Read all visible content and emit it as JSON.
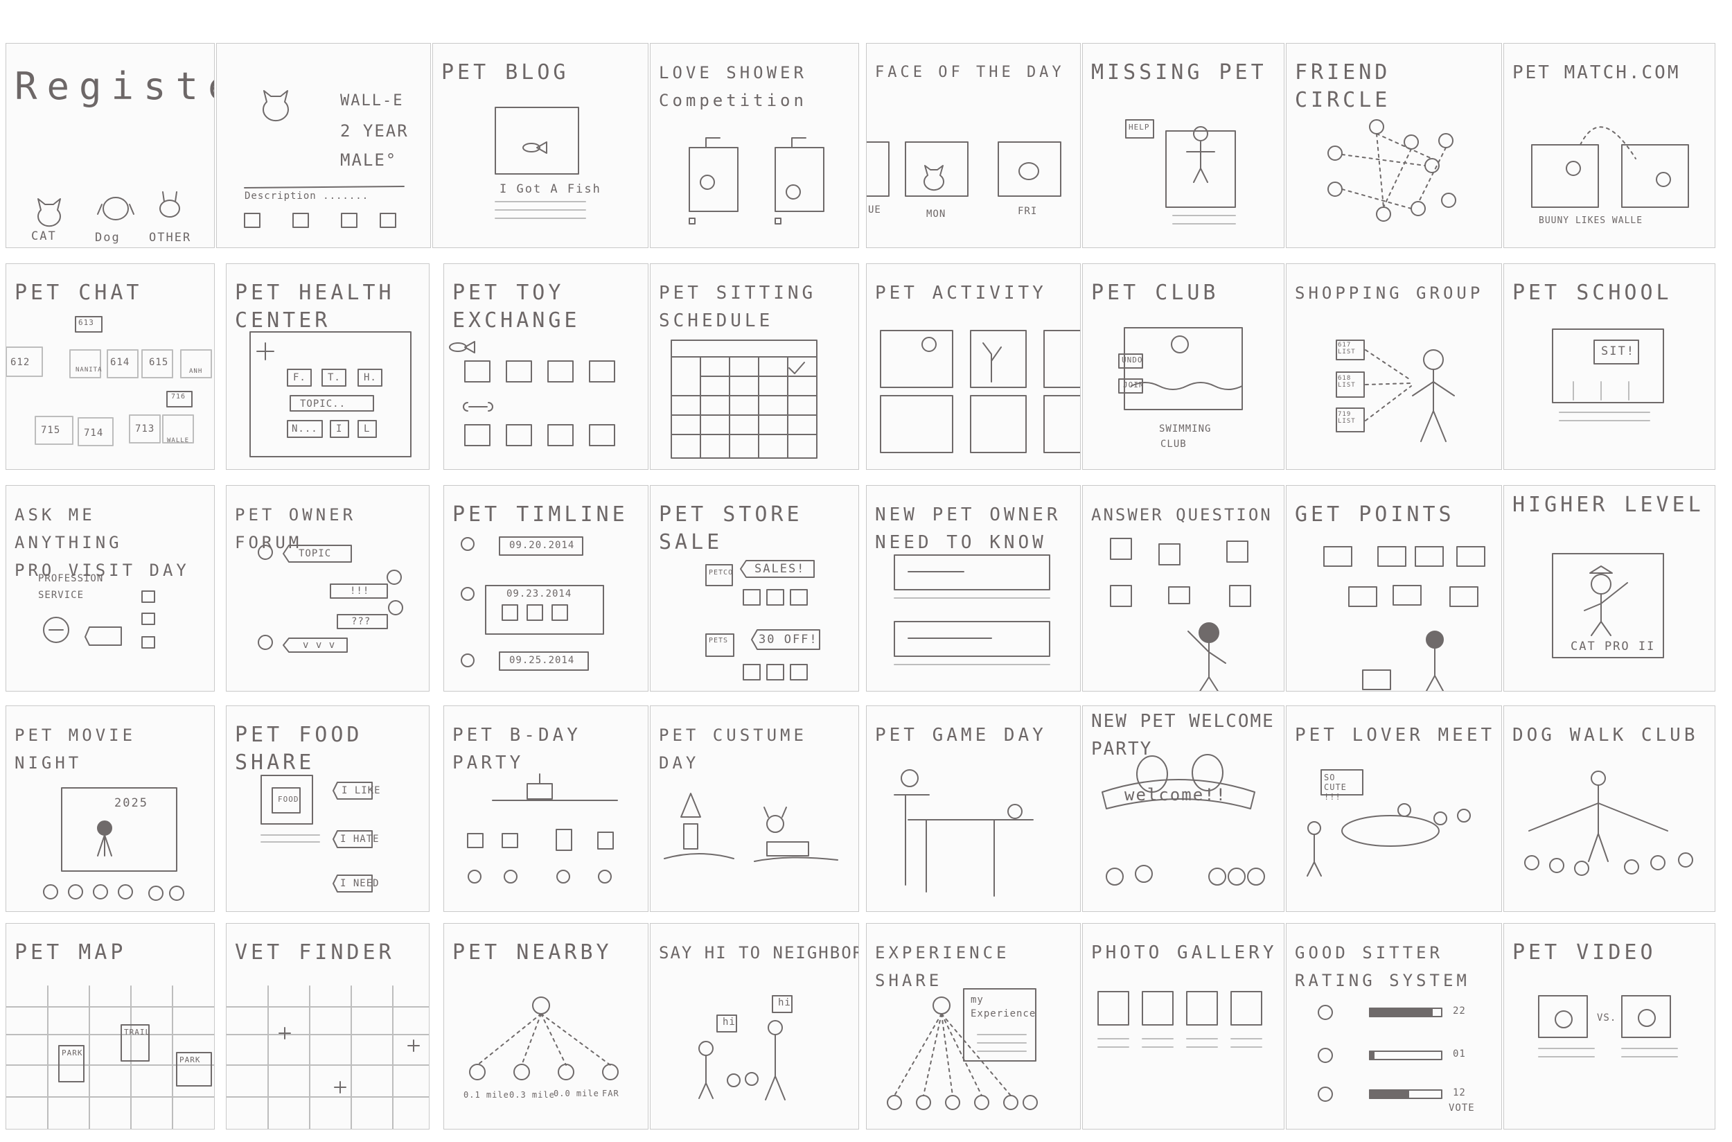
{
  "panels": [
    {
      "id": "register",
      "title": "Register",
      "labels": [
        "CAT",
        "Dog",
        "OTHER"
      ]
    },
    {
      "id": "profile",
      "title": "",
      "labels": [
        "WALL-E",
        "2 YEAR",
        "MALE°",
        "Description ......."
      ]
    },
    {
      "id": "pet-blog",
      "title": "PET BLOG",
      "labels": [
        "I Got A Fish"
      ]
    },
    {
      "id": "love-shower",
      "title": "LOVE SHOWER\nCompetition",
      "labels": []
    },
    {
      "id": "face-of-the-day",
      "title": "FACE OF THE DAY",
      "labels": [
        "UE",
        "MON",
        "FRI"
      ]
    },
    {
      "id": "missing-pet",
      "title": "MISSING PET",
      "labels": [
        "HELP"
      ]
    },
    {
      "id": "friend-circle",
      "title": "FRIEND CIRCLE",
      "labels": []
    },
    {
      "id": "pet-match",
      "title": "PET MATCH.COM",
      "labels": [
        "BUUNY LIKES WALLE"
      ]
    },
    {
      "id": "pet-chat",
      "title": "PET CHAT",
      "labels": [
        "612",
        "613",
        "614",
        "615",
        "715",
        "714",
        "713",
        "716",
        "WALLE",
        "NANITA",
        "ANH"
      ]
    },
    {
      "id": "pet-health",
      "title": "PET HEALTH\nCENTER",
      "labels": [
        "TOPIC..",
        "F.",
        "T.",
        "H.",
        "N...",
        "I",
        "L"
      ]
    },
    {
      "id": "pet-toy",
      "title": "PET TOY\nEXCHANGE",
      "labels": []
    },
    {
      "id": "pet-sitting",
      "title": "PET SITTING\nSCHEDULE",
      "labels": []
    },
    {
      "id": "pet-activity",
      "title": "PET ACTIVITY",
      "labels": []
    },
    {
      "id": "pet-club",
      "title": "PET CLUB",
      "labels": [
        "UNDO",
        "JOIN",
        "SWIMMING",
        "CLUB"
      ]
    },
    {
      "id": "shopping-group",
      "title": "SHOPPING GROUP",
      "labels": [
        "617 LIST",
        "618 LIST",
        "719 LIST"
      ]
    },
    {
      "id": "pet-school",
      "title": "PET SCHOOL",
      "labels": [
        "SIT!"
      ]
    },
    {
      "id": "ask-me",
      "title": "ASK ME ANYTHING\nPRO VISIT DAY",
      "labels": [
        "PROFESSION",
        "SERVICE"
      ]
    },
    {
      "id": "owner-forum",
      "title": "PET OWNER FORUM",
      "labels": [
        "TOPIC",
        "!!!",
        "???",
        "v v v"
      ]
    },
    {
      "id": "pet-timeline",
      "title": "PET TIMLINE",
      "labels": [
        "09.20.2014",
        "09.23.2014",
        "09.25.2014"
      ]
    },
    {
      "id": "store-sale",
      "title": "PET STORE SALE",
      "labels": [
        "SALES!",
        "30 OFF!",
        "PETCO",
        "PETS"
      ]
    },
    {
      "id": "new-owner",
      "title": "NEW PET OWNER\nNEED TO KNOW",
      "labels": []
    },
    {
      "id": "answer-question",
      "title": "ANSWER QUESTION",
      "labels": []
    },
    {
      "id": "get-points",
      "title": "GET POINTS",
      "labels": []
    },
    {
      "id": "higher-level",
      "title": "HIGHER LEVEL",
      "labels": [
        "CAT PRO II"
      ]
    },
    {
      "id": "movie-night",
      "title": "PET MOVIE NIGHT",
      "labels": [
        "2025"
      ]
    },
    {
      "id": "food-share",
      "title": "PET FOOD SHARE",
      "labels": [
        "I LIKE",
        "I HATE",
        "I NEED",
        "FOOD"
      ]
    },
    {
      "id": "bday-party",
      "title": "PET B-DAY PARTY",
      "labels": []
    },
    {
      "id": "costume-day",
      "title": "PET CUSTUME DAY",
      "labels": []
    },
    {
      "id": "game-day",
      "title": "PET GAME DAY",
      "labels": []
    },
    {
      "id": "welcome-party",
      "title": "NEW PET WELCOME\nPARTY",
      "labels": [
        "welcome!!"
      ]
    },
    {
      "id": "lover-meet",
      "title": "PET LOVER MEET",
      "labels": [
        "SO CUTE !!!"
      ]
    },
    {
      "id": "dog-walk",
      "title": "DOG WALK CLUB",
      "labels": []
    },
    {
      "id": "pet-map",
      "title": "PET MAP",
      "labels": [
        "PARK",
        "TRAIL",
        "PARK"
      ]
    },
    {
      "id": "vet-finder",
      "title": "VET FINDER",
      "labels": []
    },
    {
      "id": "pet-nearby",
      "title": "PET NEARBY",
      "labels": [
        "0.1 mile",
        "0.3 mile",
        "0.0 mile",
        "FAR"
      ]
    },
    {
      "id": "say-hi",
      "title": "SAY HI TO NEIGHBOR",
      "labels": [
        "hi",
        "hi"
      ]
    },
    {
      "id": "experience-share",
      "title": "EXPERIENCE\nSHARE",
      "labels": [
        "my",
        "Experience"
      ]
    },
    {
      "id": "photo-gallery",
      "title": "PHOTO GALLERY",
      "labels": []
    },
    {
      "id": "good-sitter",
      "title": "GOOD SITTER\nRATING SYSTEM",
      "labels": [
        "22",
        "01",
        "12",
        "VOTE"
      ]
    },
    {
      "id": "pet-video",
      "title": "PET VIDEO",
      "labels": [
        "VS."
      ]
    }
  ]
}
